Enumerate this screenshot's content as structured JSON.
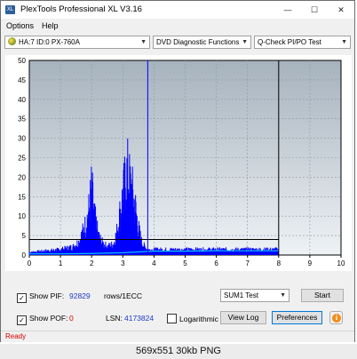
{
  "window": {
    "title": "PlexTools Professional XL V3.16",
    "minimize": "—",
    "maximize": "☐",
    "close": "✕"
  },
  "menu": [
    "Options",
    "Help"
  ],
  "toolbar": {
    "drive": "HA:7 ID:0  PX-760A",
    "function": "DVD Diagnostic Functions",
    "test": "Q-Check PI/PO Test"
  },
  "chart_data": {
    "type": "area",
    "title": "",
    "xlabel": "",
    "ylabel": "",
    "xlim": [
      0,
      10
    ],
    "ylim": [
      0,
      50
    ],
    "x_ticks": [
      "0",
      "1",
      "2",
      "3",
      "4",
      "5",
      "6",
      "7",
      "8",
      "9",
      "10"
    ],
    "y_ticks": [
      "50",
      "45",
      "40",
      "35",
      "30",
      "25",
      "20",
      "15",
      "10",
      "5",
      "0"
    ],
    "threshold": 4,
    "cursor_x": 3.8,
    "end_marker_x": 8,
    "series": [
      {
        "color": "#0000ff",
        "x": [
          0.0,
          0.5,
          1.0,
          1.4,
          1.6,
          1.7,
          1.8,
          1.9,
          1.95,
          2.0,
          2.05,
          2.1,
          2.2,
          2.3,
          2.5,
          2.7,
          2.8,
          2.9,
          3.0,
          3.1,
          3.15,
          3.2,
          3.25,
          3.3,
          3.4,
          3.5,
          3.6,
          3.7,
          3.8,
          4.0,
          4.5,
          5.0,
          5.5,
          6.0,
          6.5,
          7.0,
          7.5,
          8.0
        ],
        "values": [
          1,
          1.5,
          2,
          3,
          5,
          8,
          11,
          16,
          20,
          25,
          19,
          14,
          8,
          5,
          3,
          4,
          8,
          15,
          22,
          29,
          31,
          28,
          26,
          24,
          18,
          10,
          5,
          3,
          2,
          2,
          2,
          2,
          2,
          2,
          2,
          2,
          2,
          2
        ]
      },
      {
        "color": "#00c0ff",
        "x": [
          0,
          1,
          2,
          3,
          4,
          5,
          6,
          7,
          8
        ],
        "values": [
          0.3,
          0.3,
          0.4,
          0.6,
          1.0,
          1.0,
          1.1,
          1.1,
          1.1
        ]
      }
    ]
  },
  "controls": {
    "show_pif_label": "Show PIF:",
    "pif_value": "92829",
    "rows_label": "rows/1ECC",
    "show_pof_label": "Show POF:",
    "pof_value": "0",
    "lsn_label": "LSN:",
    "lsn_value": "4173824",
    "log_label": "Logarithmic",
    "sum_select": "SUM1 Test",
    "start": "Start",
    "view_log": "View Log",
    "preferences": "Preferences",
    "info": "i"
  },
  "status": "Ready",
  "caption": "569x551  30kb  PNG",
  "colors": {
    "plot_bg_top": "#a6b2bd",
    "plot_bg_bottom": "#eef2f5",
    "pi_series": "#0000ff",
    "po_series": "#00c0ff",
    "status_text": "#d40000"
  }
}
